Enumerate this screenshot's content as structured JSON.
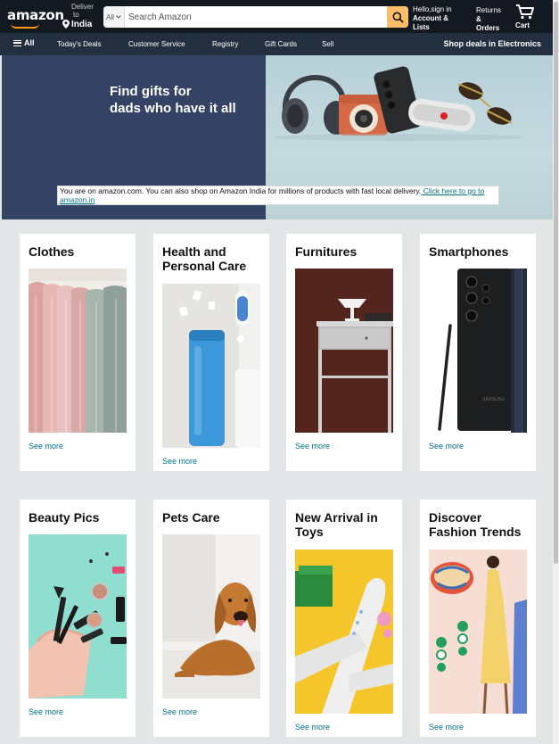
{
  "header": {
    "logo": "amazon",
    "deliver_line1": "Deliver",
    "deliver_line2": "to",
    "deliver_country": "India",
    "search_category": "All",
    "search_placeholder": "Search Amazon",
    "account_line1": "Hello,sign in",
    "account_line2": "Account &",
    "account_line3": "Lists",
    "returns_line1": "Returns",
    "returns_line2": "&",
    "returns_line3": "Orders",
    "cart_label": "Cart"
  },
  "subnav": {
    "all": "All",
    "items": [
      "Today's Deals",
      "Customer Service",
      "Registry",
      "Gift Cards",
      "Sell"
    ],
    "right": "Shop deals in Electronics"
  },
  "hero": {
    "title_line1": "Find gifts for",
    "title_line2": "dads who have it all",
    "notice_text": "You are on amazon.com. You can also shop on Amazon India for millions of products with fast local delivery.",
    "notice_link": " Click here to go to amazon.in"
  },
  "cards": [
    {
      "title": "Clothes",
      "see_more": "See more"
    },
    {
      "title": "Health and Personal Care",
      "see_more": "See more"
    },
    {
      "title": "Furnitures",
      "see_more": "See more"
    },
    {
      "title": "Smartphones",
      "see_more": "See more"
    },
    {
      "title": "Beauty Pics",
      "see_more": "See more"
    },
    {
      "title": "Pets Care",
      "see_more": "See more"
    },
    {
      "title": "New Arrival in Toys",
      "see_more": "See more"
    },
    {
      "title": "Discover Fashion Trends",
      "see_more": "See more"
    }
  ],
  "colors": {
    "nav_bg": "#131921",
    "subnav_bg": "#232f3e",
    "accent": "#febd69",
    "link": "#007185",
    "page_bg": "#e3e6e6"
  },
  "icons": [
    "search-icon",
    "location-pin-icon",
    "cart-icon",
    "hamburger-icon",
    "chevron-down-icon"
  ]
}
